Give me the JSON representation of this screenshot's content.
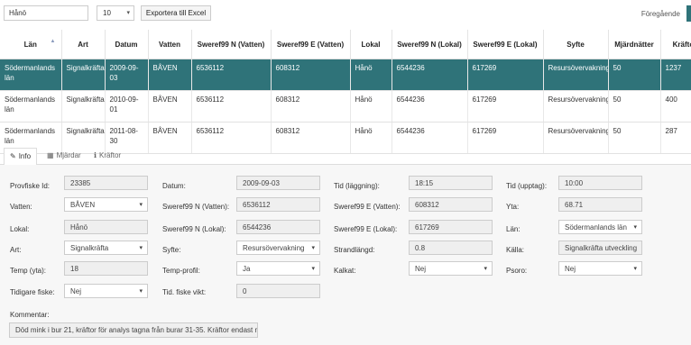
{
  "toolbar": {
    "search_value": "Hånö",
    "page_size": "10",
    "export_label": "Exportera till Excel",
    "previous_label": "Föregående"
  },
  "table": {
    "headers": [
      "Län",
      "Art",
      "Datum",
      "Vatten",
      "Sweref99 N (Vatten)",
      "Sweref99 E (Vatten)",
      "Lokal",
      "Sweref99 N (Lokal)",
      "Sweref99 E (Lokal)",
      "Syfte",
      "Mjärdnätter",
      "Kräftor"
    ],
    "rows": [
      [
        "Södermanlands län",
        "Signalkräfta",
        "2009-09-03",
        "BÅVEN",
        "6536112",
        "608312",
        "Hånö",
        "6544236",
        "617269",
        "Resursövervakning",
        "50",
        "1237"
      ],
      [
        "Södermanlands län",
        "Signalkräfta",
        "2010-09-01",
        "BÅVEN",
        "6536112",
        "608312",
        "Hånö",
        "6544236",
        "617269",
        "Resursövervakning",
        "50",
        "400"
      ],
      [
        "Södermanlands län",
        "Signalkräfta",
        "2011-08-30",
        "BÅVEN",
        "6536112",
        "608312",
        "Hånö",
        "6544236",
        "617269",
        "Resursövervakning",
        "50",
        "287"
      ]
    ]
  },
  "tabs": [
    {
      "label": "Info",
      "icon": "pencil-icon"
    },
    {
      "label": "Mjärdar",
      "icon": "table-icon"
    },
    {
      "label": "Kräftor",
      "icon": "info-icon"
    }
  ],
  "form": {
    "provfiske_id": {
      "label": "Provfiske Id:",
      "value": "23385"
    },
    "vatten": {
      "label": "Vatten:",
      "value": "BÅVEN"
    },
    "lokal": {
      "label": "Lokal:",
      "value": "Hånö"
    },
    "art": {
      "label": "Art:",
      "value": "Signalkräfta"
    },
    "temp_yta": {
      "label": "Temp (yta):",
      "value": "18"
    },
    "tidigare_fiske": {
      "label": "Tidigare fiske:",
      "value": "Nej"
    },
    "datum": {
      "label": "Datum:",
      "value": "2009-09-03"
    },
    "sweref_n_vatten": {
      "label": "Sweref99 N (Vatten):",
      "value": "6536112"
    },
    "sweref_n_lokal": {
      "label": "Sweref99 N (Lokal):",
      "value": "6544236"
    },
    "syfte": {
      "label": "Syfte:",
      "value": "Resursövervakning"
    },
    "temp_profil": {
      "label": "Temp-profil:",
      "value": "Ja"
    },
    "tid_fiske_vikt": {
      "label": "Tid. fiske vikt:",
      "value": "0"
    },
    "tid_laggning": {
      "label": "Tid (läggning):",
      "value": "18:15"
    },
    "sweref_e_vatten": {
      "label": "Sweref99 E (Vatten):",
      "value": "608312"
    },
    "sweref_e_lokal": {
      "label": "Sweref99 E (Lokal):",
      "value": "617269"
    },
    "strandlangd": {
      "label": "Strandlängd:",
      "value": "0.8"
    },
    "kalkat": {
      "label": "Kalkat:",
      "value": "Nej"
    },
    "tid_upptag": {
      "label": "Tid (upptag):",
      "value": "10:00"
    },
    "yta": {
      "label": "Yta:",
      "value": "68.71"
    },
    "lan": {
      "label": "Län:",
      "value": "Södermanlands län"
    },
    "kalla": {
      "label": "Källa:",
      "value": "Signalkräfta utveckling"
    },
    "psoro": {
      "label": "Psoro:",
      "value": "Nej"
    },
    "kommentar": {
      "label": "Kommentar:",
      "value": "Död mink i bur 21, kräftor för analys tagna från burar 31-35. Kräftor endast mä"
    }
  },
  "colors": {
    "selected_row": "#2f7379",
    "form_bg": "#f7f7f7"
  }
}
